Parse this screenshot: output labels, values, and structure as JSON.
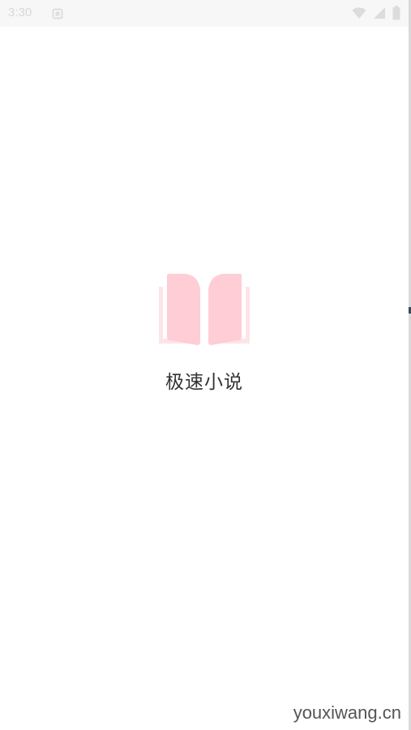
{
  "status_bar": {
    "time": "3:30",
    "icons": [
      "notification-icon",
      "wifi-icon",
      "signal-icon",
      "battery-icon"
    ]
  },
  "splash": {
    "logo_icon": "open-book-icon",
    "logo_color": "#ffcdd5",
    "app_name": "极速小说"
  },
  "watermark": {
    "text": "youxiwang.cn"
  }
}
